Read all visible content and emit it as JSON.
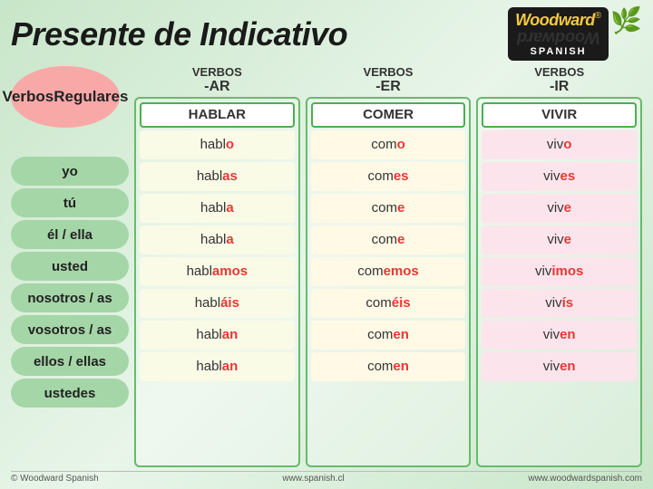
{
  "header": {
    "title": "Presente de Indicativo",
    "logo": {
      "brand": "Woodward",
      "registered": "®",
      "sub": "SPANISH"
    }
  },
  "leftCol": {
    "label_line1": "Verbos",
    "label_line2": "Regulares"
  },
  "columns": [
    {
      "id": "ar",
      "header_prefix": "VERBOS",
      "header_suffix": "-AR",
      "example": "HABLAR",
      "forms": [
        {
          "base": "habl",
          "suffix": "o"
        },
        {
          "base": "habl",
          "suffix": "as"
        },
        {
          "base": "habl",
          "suffix": "a"
        },
        {
          "base": "habl",
          "suffix": "a"
        },
        {
          "base": "habl",
          "suffix": "amos"
        },
        {
          "base": "habl",
          "suffix": "áis"
        },
        {
          "base": "habl",
          "suffix": "an"
        },
        {
          "base": "habl",
          "suffix": "an"
        }
      ]
    },
    {
      "id": "er",
      "header_prefix": "VERBOS",
      "header_suffix": "-ER",
      "example": "COMER",
      "forms": [
        {
          "base": "com",
          "suffix": "o"
        },
        {
          "base": "com",
          "suffix": "es"
        },
        {
          "base": "com",
          "suffix": "e"
        },
        {
          "base": "com",
          "suffix": "e"
        },
        {
          "base": "com",
          "suffix": "emos"
        },
        {
          "base": "com",
          "suffix": "éis"
        },
        {
          "base": "com",
          "suffix": "en"
        },
        {
          "base": "com",
          "suffix": "en"
        }
      ]
    },
    {
      "id": "ir",
      "header_prefix": "VERBOS",
      "header_suffix": "-IR",
      "example": "VIVIR",
      "forms": [
        {
          "base": "viv",
          "suffix": "o"
        },
        {
          "base": "viv",
          "suffix": "es"
        },
        {
          "base": "viv",
          "suffix": "e"
        },
        {
          "base": "viv",
          "suffix": "e"
        },
        {
          "base": "viv",
          "suffix": "imos"
        },
        {
          "base": "viv",
          "suffix": "ís"
        },
        {
          "base": "viv",
          "suffix": "en"
        },
        {
          "base": "viv",
          "suffix": "en"
        }
      ]
    }
  ],
  "pronouns": [
    "yo",
    "tú",
    "él / ella",
    "usted",
    "nosotros / as",
    "vosotros / as",
    "ellos / ellas",
    "ustedes"
  ],
  "footer": {
    "left": "© Woodward Spanish",
    "center": "www.spanish.cl",
    "right": "www.woodwardspanish.com"
  }
}
